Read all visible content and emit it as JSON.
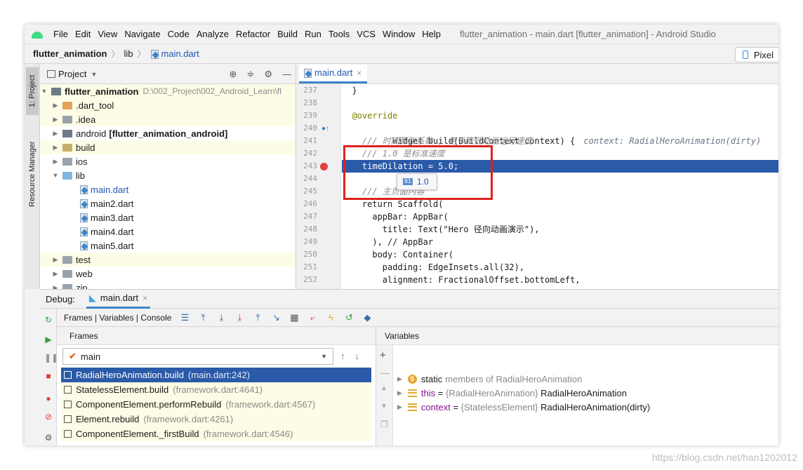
{
  "menu": {
    "items": [
      "File",
      "Edit",
      "View",
      "Navigate",
      "Code",
      "Analyze",
      "Refactor",
      "Build",
      "Run",
      "Tools",
      "VCS",
      "Window",
      "Help"
    ],
    "window_title": "flutter_animation - main.dart [flutter_animation] - Android Studio"
  },
  "breadcrumb": {
    "project": "flutter_animation",
    "folder": "lib",
    "file": "main.dart",
    "device": "Pixel"
  },
  "left_strip": {
    "project_tab": "1: Project",
    "resource_tab": "Resource Manager"
  },
  "project_panel": {
    "title": "Project",
    "root": {
      "name": "flutter_animation",
      "path": "D:\\002_Project\\002_Android_Learn\\fl"
    },
    "items": [
      {
        "name": ".dart_tool"
      },
      {
        "name": ".idea"
      },
      {
        "name": "android",
        "suffix": "[flutter_animation_android]"
      },
      {
        "name": "build"
      },
      {
        "name": "ios"
      },
      {
        "name": "lib"
      },
      {
        "name": "main.dart"
      },
      {
        "name": "main2.dart"
      },
      {
        "name": "main3.dart"
      },
      {
        "name": "main4.dart"
      },
      {
        "name": "main5.dart"
      },
      {
        "name": "test"
      },
      {
        "name": "web"
      },
      {
        "name": "zip"
      }
    ]
  },
  "editor": {
    "tab_label": "main.dart",
    "lines": [
      {
        "n": "237",
        "text": "  }"
      },
      {
        "n": "238",
        "text": ""
      },
      {
        "n": "239",
        "text": "  @override"
      },
      {
        "n": "240",
        "text": "  Widget build(BuildContext context) {",
        "hint": "context: RadialHeroAnimation(dirty)"
      },
      {
        "n": "241",
        "text": "    /// 时间膨胀系数 , 用于降低动画运行速度"
      },
      {
        "n": "242",
        "text": "    /// 1.0 是标准速度"
      },
      {
        "n": "243",
        "text": "    timeDilation = 5.0;"
      },
      {
        "n": "244",
        "text": ""
      },
      {
        "n": "245",
        "text": "    /// 主页面内容"
      },
      {
        "n": "246",
        "text": "    return Scaffold("
      },
      {
        "n": "247",
        "text": "      appBar: AppBar("
      },
      {
        "n": "248",
        "text": "        title: Text(\"Hero 径向动画演示\"),"
      },
      {
        "n": "249",
        "text": "      ), // AppBar"
      },
      {
        "n": "250",
        "text": "      body: Container("
      },
      {
        "n": "251",
        "text": "        padding: EdgeInsets.all(32),"
      },
      {
        "n": "252",
        "text": "        alignment: FractionalOffset.bottomLeft,"
      }
    ],
    "tooltip_value": "1.0",
    "tooltip_icon": "01"
  },
  "debug": {
    "label": "Debug:",
    "tab_label": "main.dart",
    "toolbar_tabs": "Frames | Variables | Console",
    "frames_title": "Frames",
    "thread": "main",
    "frames": [
      {
        "method": "RadialHeroAnimation.build",
        "loc": "(main.dart:242)"
      },
      {
        "method": "StatelessElement.build",
        "loc": "(framework.dart:4641)"
      },
      {
        "method": "ComponentElement.performRebuild",
        "loc": "(framework.dart:4567)"
      },
      {
        "method": "Element.rebuild",
        "loc": "(framework.dart:4261)"
      },
      {
        "method": "ComponentElement._firstBuild",
        "loc": "(framework.dart:4546)"
      }
    ],
    "variables_title": "Variables",
    "variables": [
      {
        "name": "static",
        "rest": "members of RadialHeroAnimation"
      },
      {
        "name": "this",
        "eq": " = ",
        "type": "{RadialHeroAnimation}",
        "value": " RadialHeroAnimation"
      },
      {
        "name": "context",
        "eq": " = ",
        "type": "{StatelessElement}",
        "value": " RadialHeroAnimation(dirty)"
      }
    ]
  },
  "colors": {
    "exec_line": "#2a5aa8",
    "highlight_box": "#e0221c",
    "link": "#1e57b4",
    "breakpoint": "#e0443e"
  },
  "watermark": "https://blog.csdn.net/han1202012"
}
